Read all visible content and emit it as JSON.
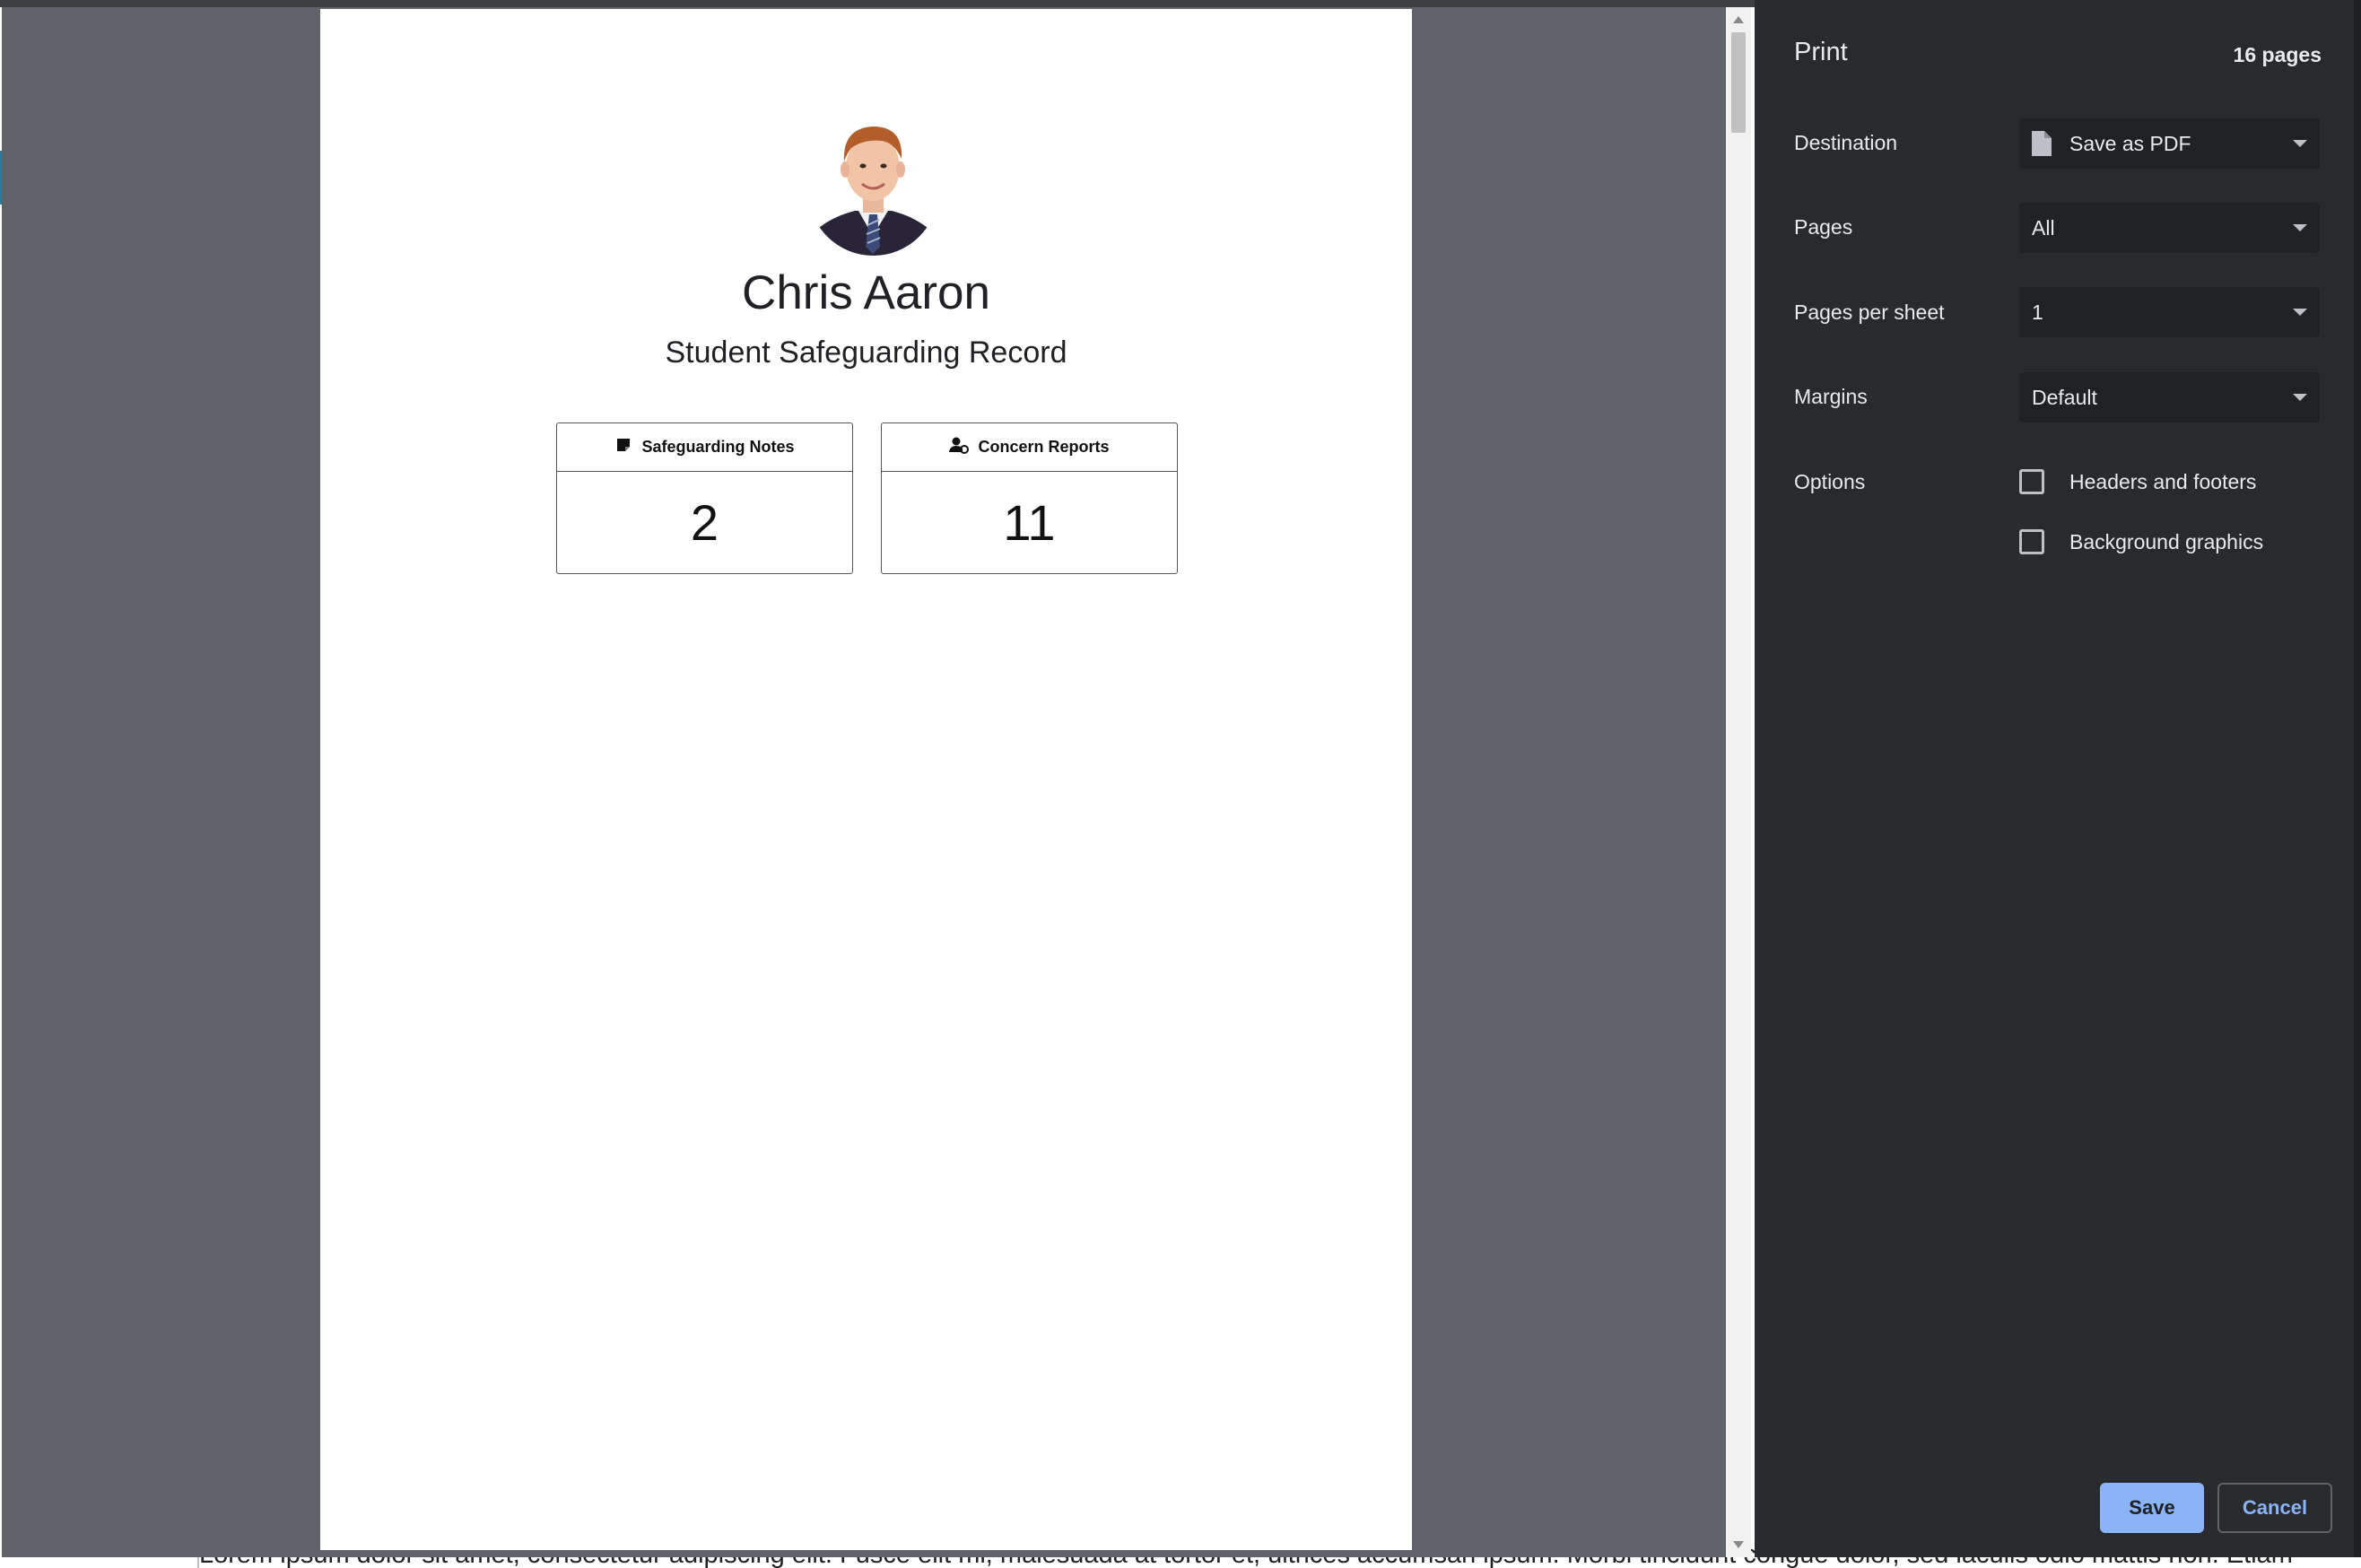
{
  "background": {
    "text": "Lorem ipsum dolor sit amet, consectetur adipiscing elit. Fusce elit mi, malesuada at tortor et, ultrices accumsan ipsum. Morbi tincidunt congue dolor, sed iaculis odio mattis non. Etiam"
  },
  "preview": {
    "student_name": "Chris Aaron",
    "subtitle": "Student Safeguarding Record",
    "cards": [
      {
        "label": "Safeguarding Notes",
        "value": "2",
        "icon": "note-icon"
      },
      {
        "label": "Concern Reports",
        "value": "11",
        "icon": "user-concern-icon"
      }
    ]
  },
  "print": {
    "title": "Print",
    "page_count": "16 pages",
    "destination": {
      "label": "Destination",
      "value": "Save as PDF"
    },
    "pages": {
      "label": "Pages",
      "value": "All"
    },
    "pages_per_sheet": {
      "label": "Pages per sheet",
      "value": "1"
    },
    "margins": {
      "label": "Margins",
      "value": "Default"
    },
    "options": {
      "label": "Options",
      "headers_footers": "Headers and footers",
      "background_graphics": "Background graphics"
    },
    "save_label": "Save",
    "cancel_label": "Cancel"
  },
  "colors": {
    "sidebar_bg": "#292a2d",
    "preview_bg": "#5f6368",
    "accent": "#8ab4f8"
  }
}
